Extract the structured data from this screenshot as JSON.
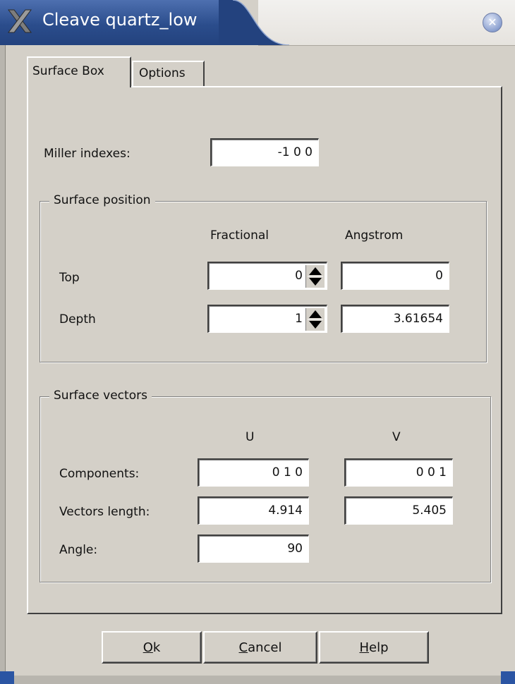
{
  "window": {
    "title": "Cleave quartz_low"
  },
  "tabs": [
    {
      "label": "Surface Box"
    },
    {
      "label": "Options"
    }
  ],
  "miller": {
    "label": "Miller indexes:",
    "value": "-1 0 0"
  },
  "surface_position": {
    "title": "Surface position",
    "col_fractional": "Fractional",
    "col_angstrom": "Angstrom",
    "top": {
      "label": "Top",
      "fractional": "0",
      "angstrom": "0"
    },
    "depth": {
      "label": "Depth",
      "fractional": "1",
      "angstrom": "3.61654"
    }
  },
  "surface_vectors": {
    "title": "Surface vectors",
    "col_u": "U",
    "col_v": "V",
    "components": {
      "label": "Components:",
      "u": "0 1 0",
      "v": "0 0 1"
    },
    "lengths": {
      "label": "Vectors length:",
      "u": "4.914",
      "v": "5.405"
    },
    "angle": {
      "label": "Angle:",
      "value": "90"
    }
  },
  "buttons": {
    "ok": {
      "mnemonic": "O",
      "rest": "k"
    },
    "cancel": {
      "mnemonic": "C",
      "rest": "ancel"
    },
    "help": {
      "mnemonic": "H",
      "rest": "elp"
    }
  },
  "icons": {
    "title": "x-window-icon",
    "close": "close-icon",
    "spin": "spin-arrows-icon"
  },
  "colors": {
    "title_bar": "#2b4d8c",
    "dialog_bg": "#d4d0c8",
    "entry_bg": "#ffffff"
  }
}
